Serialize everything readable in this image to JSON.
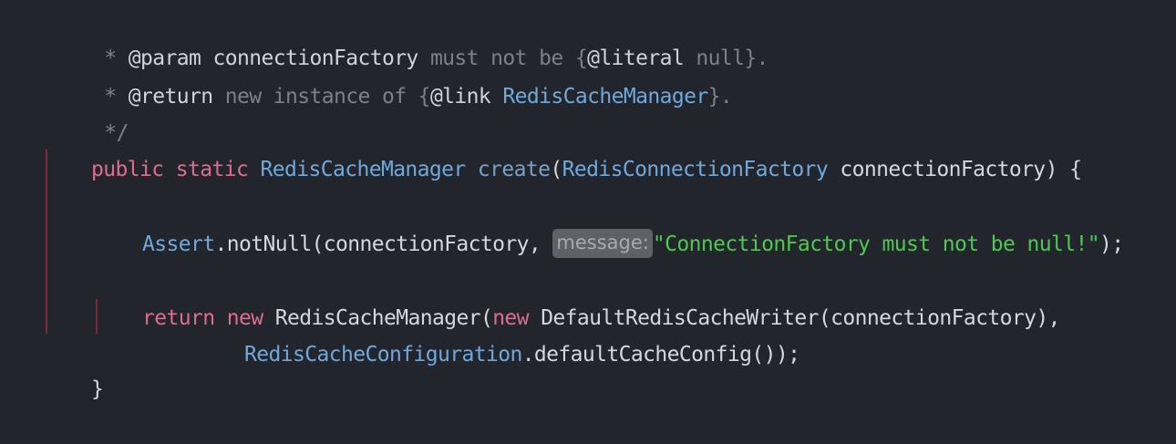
{
  "code": {
    "l1": {
      "star": " * ",
      "tag": "@param",
      "name": " connectionFactory ",
      "desc": "must not be {",
      "literal_tag": "@literal",
      "literal_val": " null}."
    },
    "l2": {
      "star": " * ",
      "tag": "@return",
      "desc": " new instance of {",
      "link_tag": "@link",
      "link_target": " RedisCacheManager",
      "tail": "}."
    },
    "l3": {
      "end": " */"
    },
    "l4": {
      "kw_public": "public",
      "kw_static": "static",
      "ret_type": "RedisCacheManager",
      "method": "create",
      "open": "(",
      "param_type": "RedisConnectionFactory",
      "param_name": " connectionFactory",
      "close": ")",
      "brace": "{"
    },
    "l6": {
      "cls": "Assert",
      "call": ".notNull(connectionFactory, ",
      "hint": "message:",
      "str": "\"ConnectionFactory must not be null!\"",
      "end": ");"
    },
    "l8": {
      "kw_return": "return",
      "kw_new": "new",
      "cls": "RedisCacheManager",
      "open": "(",
      "kw_new2": "new",
      "cls2": "DefaultRedisCacheWriter",
      "args": "(connectionFactory),"
    },
    "l9": {
      "cls": "RedisCacheConfiguration",
      "call": ".defaultCacheConfig());"
    },
    "l10": {
      "brace": "}"
    }
  }
}
